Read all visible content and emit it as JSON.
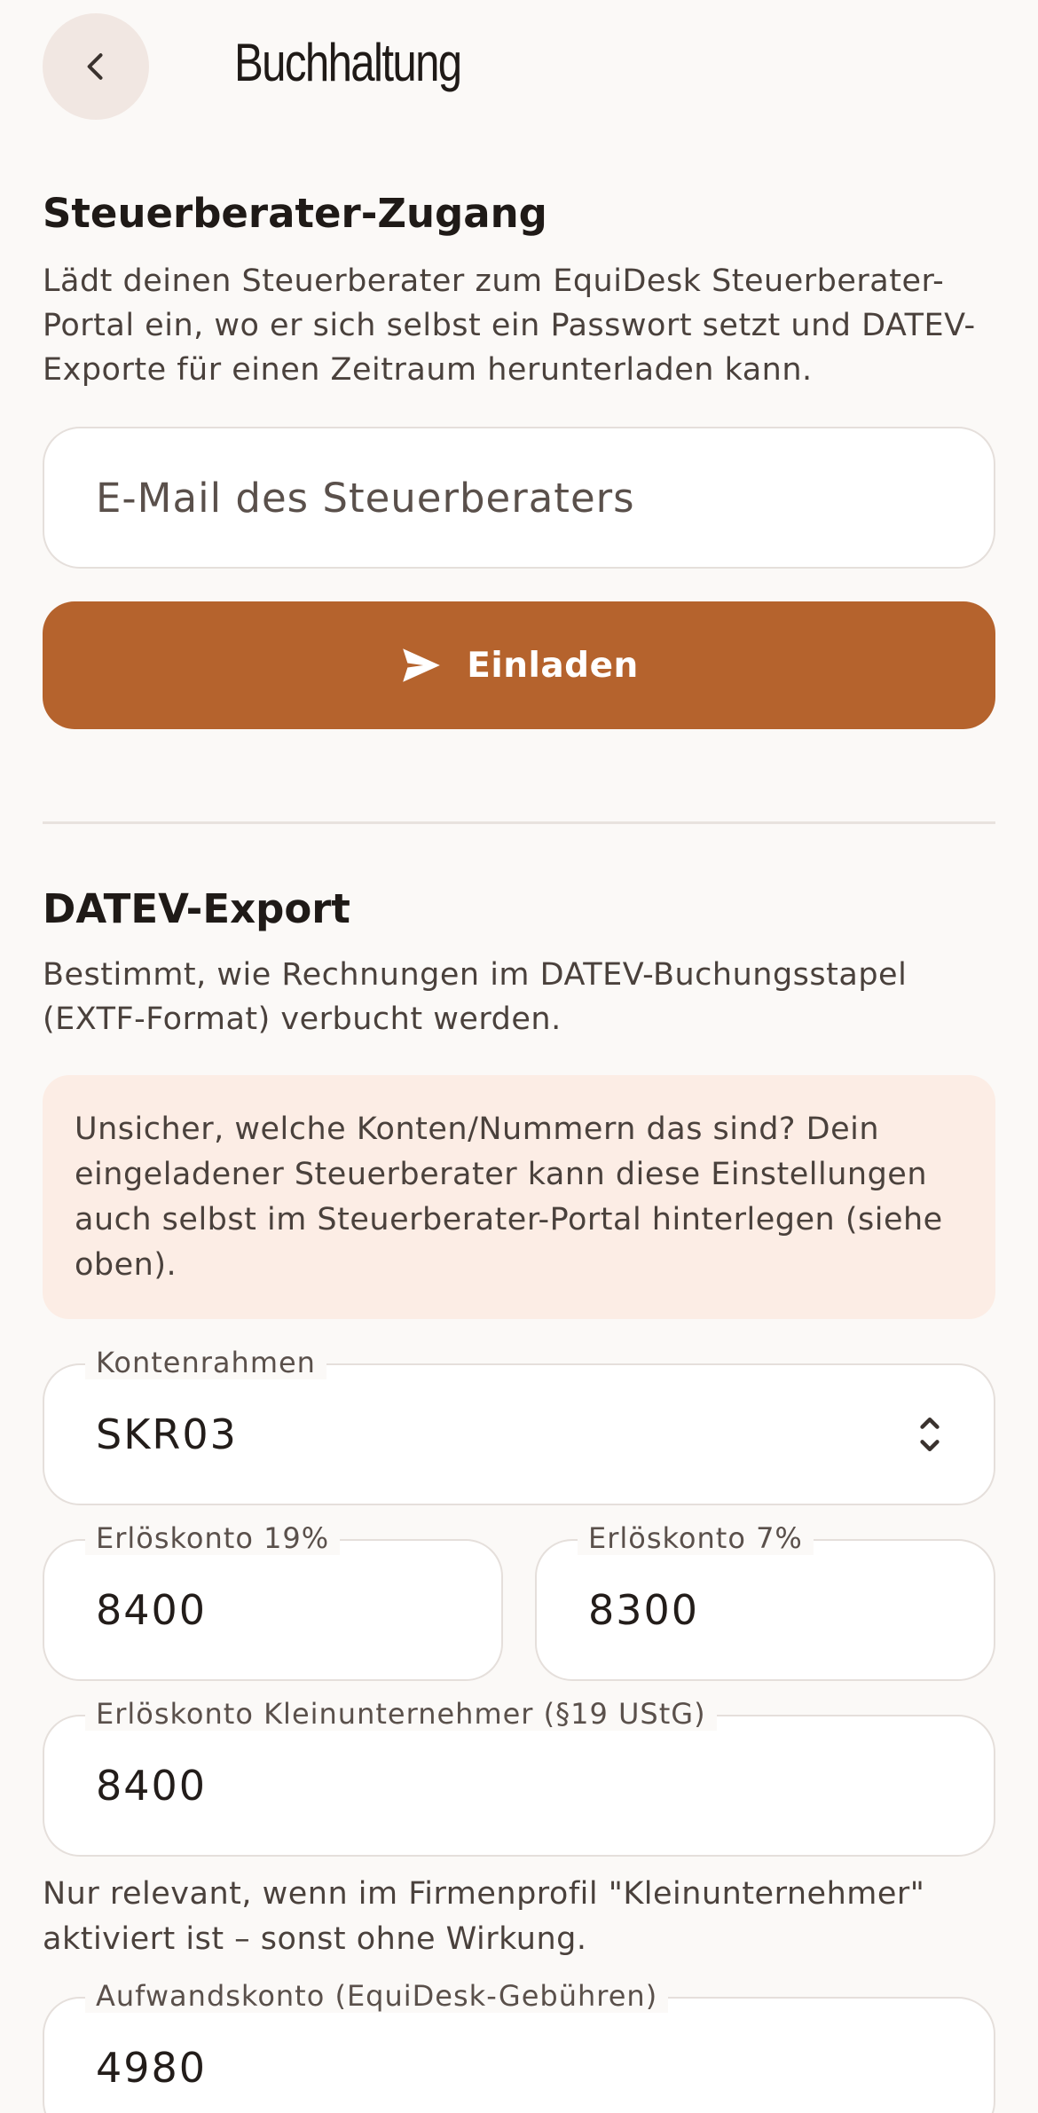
{
  "header": {
    "title": "Buchhaltung",
    "back_icon": "chevron-left-icon"
  },
  "tax_advisor": {
    "title": "Steuerberater-Zugang",
    "description": "Lädt deinen Steuerberater zum EquiDesk Steuerberater-Portal ein, wo er sich selbst ein Passwort setzt und DATEV-Exporte für einen Zeitraum herunterladen kann.",
    "email_placeholder": "E-Mail des Steuerberaters",
    "email_value": "",
    "invite_label": "Einladen",
    "invite_icon": "send-icon"
  },
  "datev": {
    "title": "DATEV-Export",
    "description": "Bestimmt, wie Rechnungen im DATEV-Buchungsstapel (EXTF-Format) verbucht werden.",
    "hint": "Unsicher, welche Konten/Nummern das sind? Dein eingeladener Steuerberater kann diese Einstellungen auch selbst im Steuerberater-Portal hinterlegen (siehe oben).",
    "kontenrahmen": {
      "label": "Kontenrahmen",
      "value": "SKR03"
    },
    "erloes19": {
      "label": "Erlöskonto 19%",
      "value": "8400"
    },
    "erloes7": {
      "label": "Erlöskonto 7%",
      "value": "8300"
    },
    "kleinunternehmer": {
      "label": "Erlöskonto Kleinunternehmer (§19 UStG)",
      "value": "8400"
    },
    "kleinunternehmer_hint": "Nur relevant, wenn im Firmenprofil \"Kleinunternehmer\" aktiviert ist – sonst ohne Wirkung.",
    "aufwand": {
      "label": "Aufwandskonto (EquiDesk-Gebühren)",
      "value": "4980"
    }
  },
  "colors": {
    "accent": "#b5632d",
    "background": "#fbf9f7",
    "hint_background": "#fcede5"
  }
}
